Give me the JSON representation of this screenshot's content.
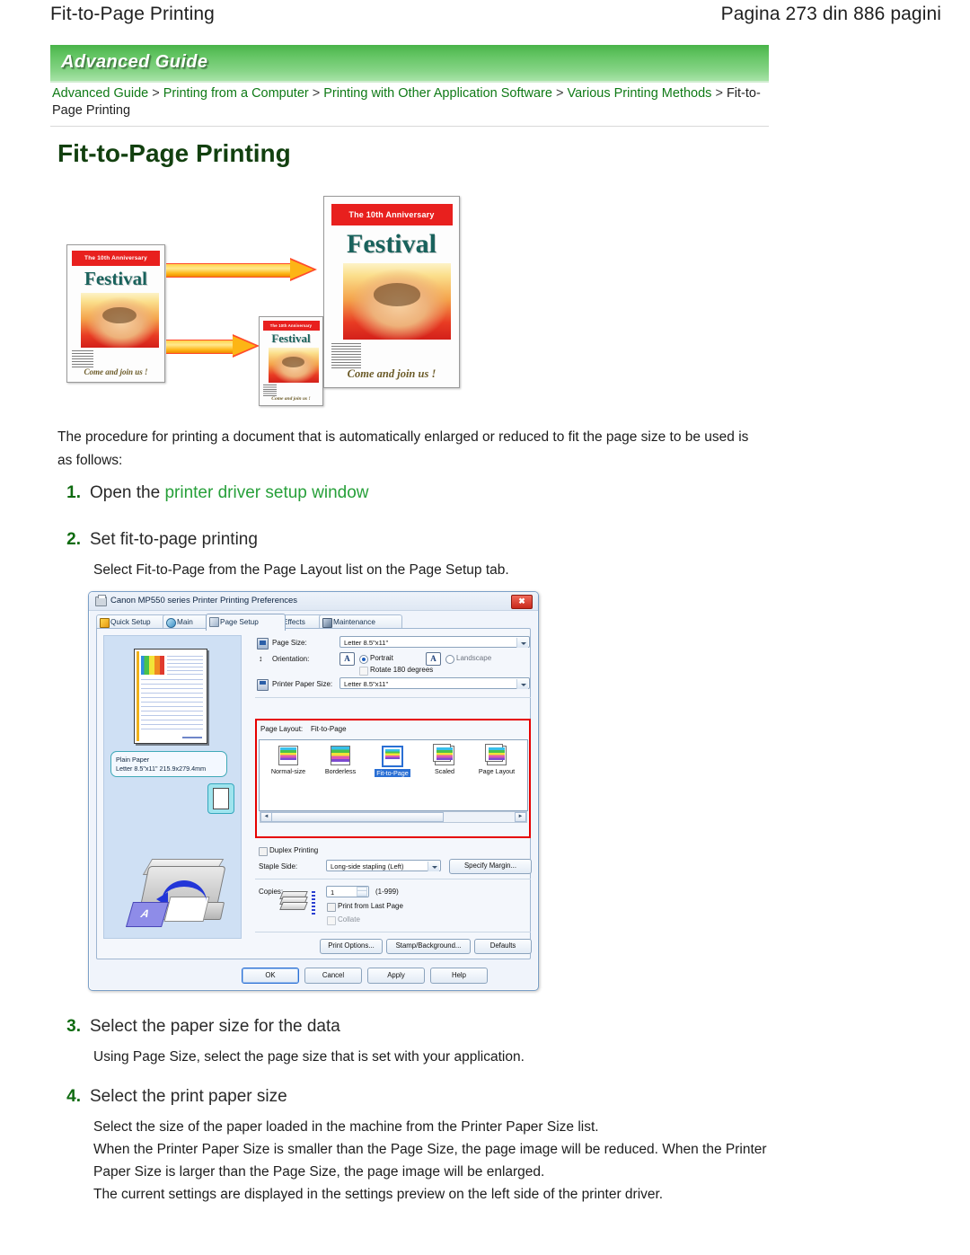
{
  "page_header": {
    "title": "Fit-to-Page Printing",
    "pagination": "Pagina 273 din 886 pagini"
  },
  "banner": {
    "label": "Advanced Guide"
  },
  "breadcrumb": {
    "items": [
      "Advanced Guide",
      "Printing from a Computer",
      "Printing with Other Application Software",
      "Various Printing Methods"
    ],
    "separator": ">",
    "current": "Fit-to-Page Printing"
  },
  "main_heading": "Fit-to-Page Printing",
  "illustration": {
    "poster_small": {
      "anniversary": "The 10th Anniversary",
      "title": "Festival",
      "footer": "Come and join us !"
    },
    "poster_tiny": {
      "anniversary": "The 10th Anniversary",
      "title": "Festival",
      "footer": "Come and join us !"
    },
    "poster_big": {
      "anniversary": "The 10th Anniversary",
      "title": "Festival",
      "footer": "Come and join us !"
    }
  },
  "intro": "The procedure for printing a document that is automatically enlarged or reduced to fit the page size to be used is as follows:",
  "steps": [
    {
      "num": "1.",
      "title_prefix": "Open the ",
      "title_link": "printer driver setup window",
      "body": ""
    },
    {
      "num": "2.",
      "title": "Set fit-to-page printing",
      "body": "Select Fit-to-Page from the Page Layout list on the Page Setup tab."
    },
    {
      "num": "3.",
      "title": "Select the paper size for the data",
      "body": "Using Page Size, select the page size that is set with your application."
    },
    {
      "num": "4.",
      "title": "Select the print paper size",
      "body": "Select the size of the paper loaded in the machine from the Printer Paper Size list.\nWhen the Printer Paper Size is smaller than the Page Size, the page image will be reduced. When the Printer Paper Size is larger than the Page Size, the page image will be enlarged.",
      "body2": "The current settings are displayed in the settings preview on the left side of the printer driver."
    }
  ],
  "dialog": {
    "title": "Canon MP550 series Printer Printing Preferences",
    "close_label": "✖",
    "tabs": [
      {
        "label": "Quick Setup",
        "active": false
      },
      {
        "label": "Main",
        "active": false
      },
      {
        "label": "Page Setup",
        "active": true
      },
      {
        "label": "Effects",
        "active": false
      },
      {
        "label": "Maintenance",
        "active": false
      }
    ],
    "preview": {
      "media_type": "Plain Paper",
      "paper_size": "Letter 8.5\"x11\" 215.9x279.4mm"
    },
    "fields": {
      "page_size_label": "Page Size:",
      "page_size_value": "Letter 8.5\"x11\"",
      "orientation_label": "Orientation:",
      "portrait_label": "Portrait",
      "landscape_label": "Landscape",
      "rotate_label": "Rotate 180 degrees",
      "printer_paper_size_label": "Printer Paper Size:",
      "printer_paper_size_value": "Letter 8.5\"x11\"",
      "page_layout_label": "Page Layout:",
      "page_layout_value": "Fit-to-Page",
      "duplex_label": "Duplex Printing",
      "staple_side_label": "Staple Side:",
      "staple_side_value": "Long-side stapling (Left)",
      "specify_margin_label": "Specify Margin...",
      "copies_label": "Copies:",
      "copies_value": "1",
      "copies_range": "(1-999)",
      "print_last_page_label": "Print from Last Page",
      "collate_label": "Collate"
    },
    "layout_options": [
      {
        "label": "Normal-size",
        "selected": false
      },
      {
        "label": "Borderless",
        "selected": false
      },
      {
        "label": "Fit-to-Page",
        "selected": true
      },
      {
        "label": "Scaled",
        "selected": false
      },
      {
        "label": "Page Layout",
        "selected": false
      }
    ],
    "scroll": {
      "left_arrow": "◄",
      "right_arrow": "►"
    },
    "secondary_buttons": [
      "Print Options...",
      "Stamp/Background...",
      "Defaults"
    ],
    "footer_buttons": [
      {
        "label": "OK",
        "default": true
      },
      {
        "label": "Cancel",
        "default": false
      },
      {
        "label": "Apply",
        "default": false
      },
      {
        "label": "Help",
        "default": false
      }
    ]
  },
  "colors": {
    "banner_green": "#62c462",
    "heading_green": "#12400f",
    "link_green": "#27a03a",
    "highlight_red": "#e60000",
    "selection_blue": "#2a6fd4"
  }
}
